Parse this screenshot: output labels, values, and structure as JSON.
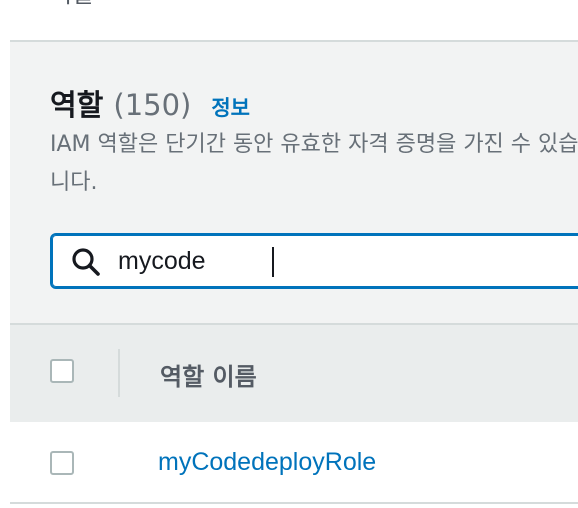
{
  "breadcrumb": {
    "fragment": "역할"
  },
  "roles_panel": {
    "title": "역할",
    "count": "(150)",
    "info_link": "정보",
    "description": "IAM 역할은 단기간 동안 유효한 자격 증명을 가진 수 있습니다."
  },
  "search": {
    "value": "mycode",
    "icon": "search-icon"
  },
  "table": {
    "columns": [
      "역할 이름"
    ],
    "rows": [
      {
        "role_name": "myCodedeployRole"
      }
    ]
  },
  "colors": {
    "link": "#0073bb",
    "panel_background": "#f2f3f3",
    "header_background": "#eaeded",
    "focus_border": "#0073bb"
  }
}
